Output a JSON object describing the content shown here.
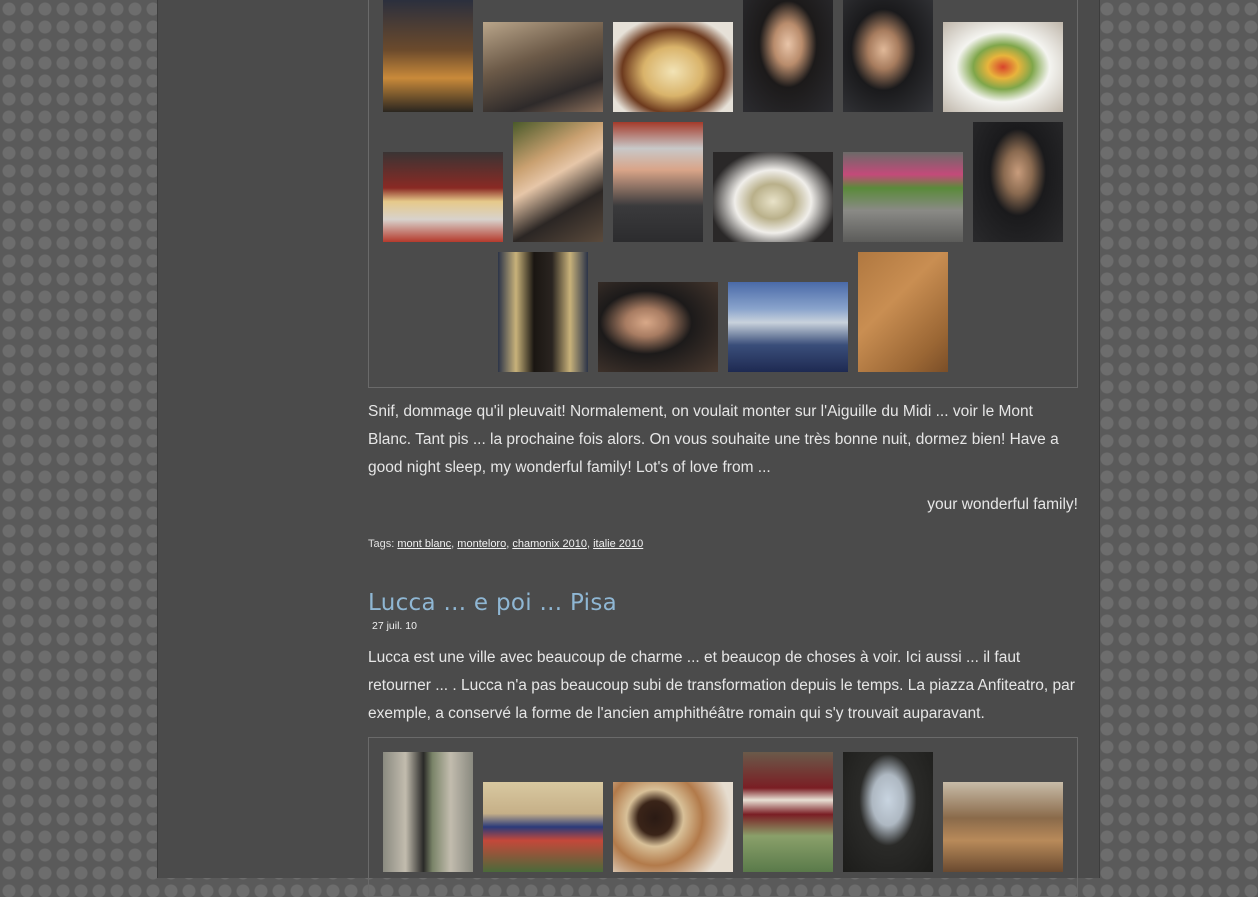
{
  "post1": {
    "paragraph": "Snif, dommage qu'il pleuvait! Normalement, on voulait monter sur l'Aiguille du Midi ... voir le Mont Blanc. Tant pis ... la prochaine fois alors. On vous souhaite une très bonne nuit, dormez bien! Have a good night sleep, my wonderful family! Lot's of love from ...",
    "signature": "your wonderful family!",
    "tags_label": "Tags:",
    "tags": [
      "mont blanc",
      "monteloro",
      "chamonix 2010",
      "italie 2010"
    ]
  },
  "post2": {
    "title": "Lucca ... e poi ... Pisa",
    "date": "27 juil. 10",
    "paragraph": "Lucca est une ville avec beaucoup de charme ... et beaucop de choses à voir. Ici aussi ... il faut retourner ... . Lucca n'a pas beaucoup subi de transformation depuis le temps. La piazza Anfiteatro, par exemple, a conservé la forme de l'ancien amphithéâtre romain qui s'y trouvait auparavant."
  }
}
